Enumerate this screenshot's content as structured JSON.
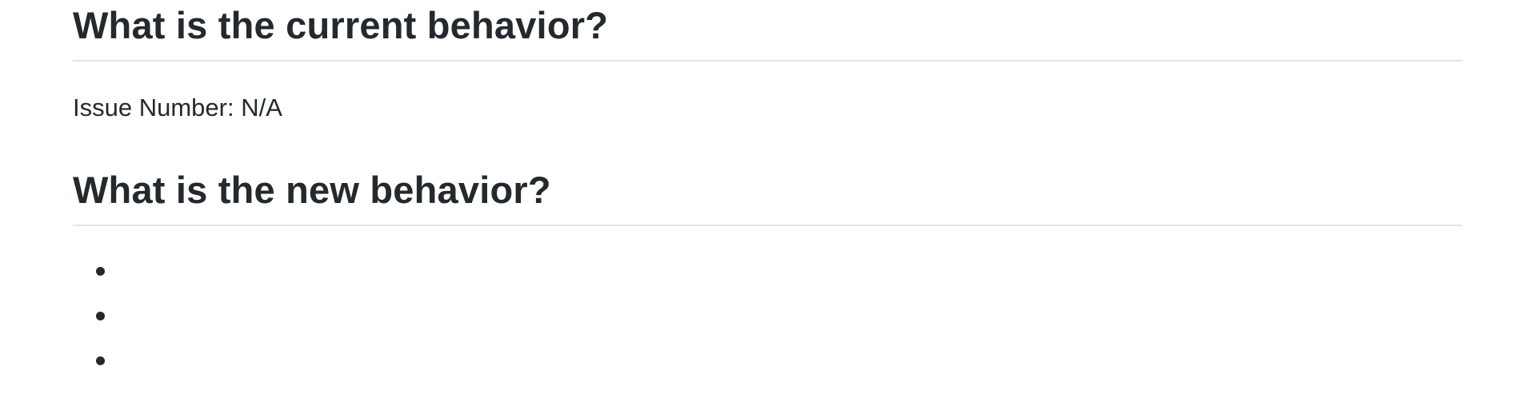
{
  "sections": [
    {
      "heading": "What is the current behavior?",
      "paragraph": "Issue Number: N/A"
    },
    {
      "heading": "What is the new behavior?",
      "list_items": [
        "",
        "",
        ""
      ]
    }
  ]
}
